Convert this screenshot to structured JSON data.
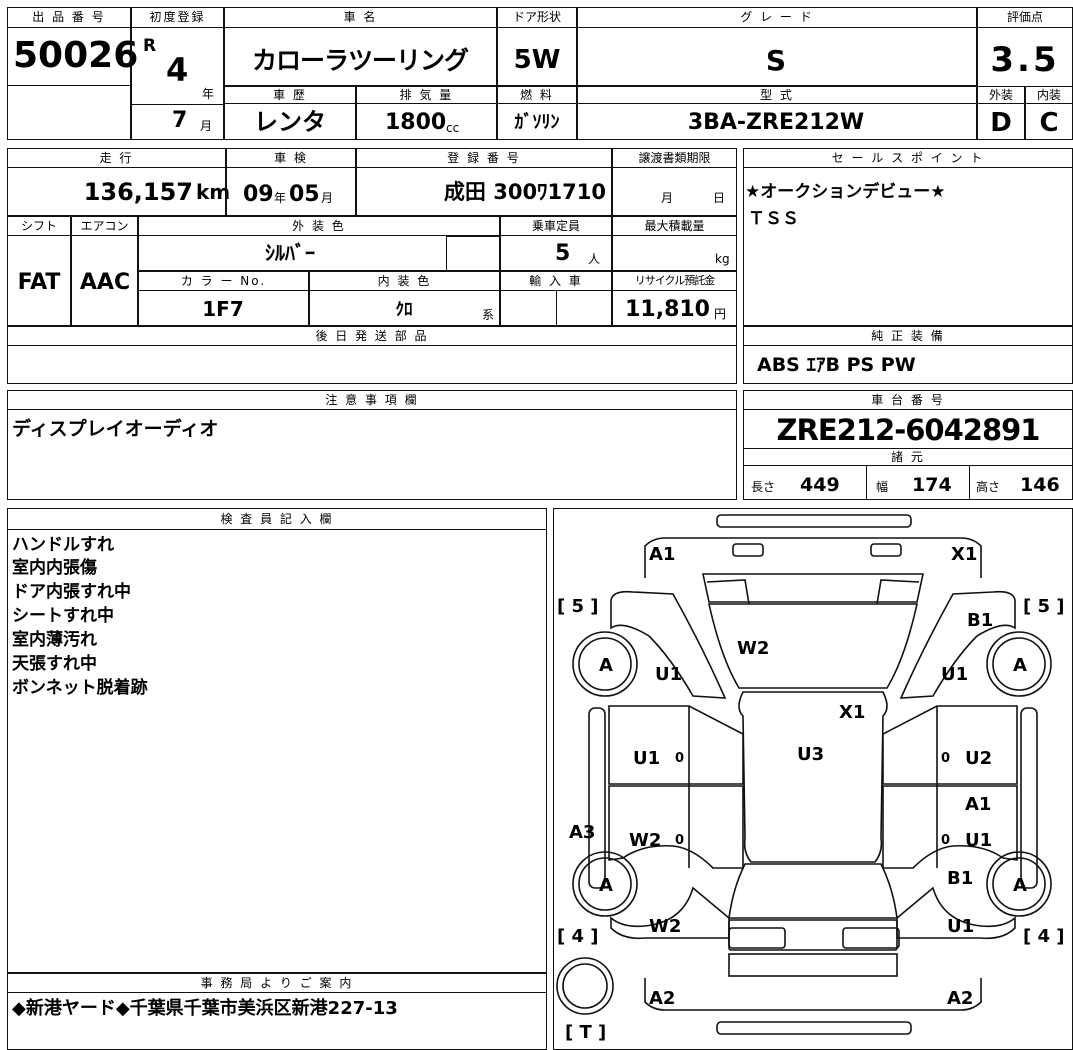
{
  "header": {
    "lot_number": {
      "label": "出 品 番 号",
      "value": "50026"
    },
    "first_registration": {
      "label": "初度登録",
      "era": "R",
      "year": "4",
      "year_unit": "年",
      "month": "7",
      "month_unit": "月"
    },
    "car_name": {
      "label": "車 名",
      "value": "カローラツーリング"
    },
    "door_type": {
      "label": "ドア形状",
      "value": "5W"
    },
    "grade": {
      "label": "グ レ ー ド",
      "value": "S"
    },
    "score": {
      "label": "評価点",
      "value": "3.5"
    },
    "history": {
      "label": "車 歴",
      "value": "レンタ"
    },
    "displacement": {
      "label": "排 気 量",
      "value": "1800",
      "unit": "cc"
    },
    "fuel": {
      "label": "燃 料",
      "value": "ｶﾞｿﾘﾝ"
    },
    "model_code": {
      "label": "型 式",
      "value": "3BA-ZRE212W"
    },
    "exterior_grade": {
      "label": "外装",
      "value": "D"
    },
    "interior_grade": {
      "label": "内装",
      "value": "C"
    }
  },
  "info": {
    "mileage": {
      "label": "走 行",
      "value": "136,157",
      "unit": "km"
    },
    "inspection": {
      "label": "車 検",
      "year": "09",
      "year_unit": "年",
      "month": "05",
      "month_unit": "月"
    },
    "registration": {
      "label": "登 録 番 号",
      "value": "成田 300ﾜ1710"
    },
    "transfer_deadline": {
      "label": "譲渡書類期限",
      "month_unit": "月",
      "day_unit": "日"
    },
    "shift": {
      "label": "シフト",
      "value": "FAT"
    },
    "aircon": {
      "label": "エアコン",
      "value": "AAC"
    },
    "exterior_color": {
      "label": "外 装 色",
      "value": "ｼﾙﾊﾞｰ"
    },
    "capacity": {
      "label": "乗車定員",
      "value": "5",
      "unit": "人"
    },
    "max_load": {
      "label": "最大積載量",
      "unit": "kg"
    },
    "color_no": {
      "label": "カ ラ ー No.",
      "value": "1F7"
    },
    "interior_color": {
      "label": "内 装 色",
      "value": "ｸﾛ",
      "unit": "系"
    },
    "import": {
      "label": "輸 入 車"
    },
    "recycle_fee": {
      "label": "リサイクル預託金",
      "value": "11,810",
      "unit": "円"
    },
    "later_parts": {
      "label": "後 日 発 送 部 品"
    }
  },
  "sales_points": {
    "label": "セ ー ル ス ポ イ ン ト",
    "lines": [
      "★オークションデビュー★",
      "ＴＳＳ"
    ]
  },
  "genuine_equipment": {
    "label": "純 正 装 備",
    "value": "ABS ｴｱB PS PW"
  },
  "notes": {
    "label": "注 意 事 項 欄",
    "value": "ディスプレイオーディオ"
  },
  "chassis": {
    "label": "車 台 番 号",
    "value": "ZRE212-6042891"
  },
  "dimensions": {
    "label": "諸 元",
    "length": {
      "label": "長さ",
      "value": "449"
    },
    "width": {
      "label": "幅",
      "value": "174"
    },
    "height": {
      "label": "高さ",
      "value": "146"
    }
  },
  "inspector": {
    "label": "検 査 員 記 入 欄",
    "lines": [
      "ハンドルすれ",
      "室内内張傷",
      "ドア内張すれ中",
      "シートすれ中",
      "室内薄汚れ",
      "天張すれ中",
      "ボンネット脱着跡"
    ]
  },
  "office": {
    "label": "事 務 局 よ り ご 案 内",
    "value": "◆新港ヤード◆千葉県千葉市美浜区新港227-13"
  },
  "diagram": {
    "marks": {
      "front_left": "A1",
      "front_right": "X1",
      "windshield": "W2",
      "left_front_fender": "U1",
      "right_front_fender": "U1",
      "roof_front": "X1",
      "left_front_door": "U1",
      "left_front_door_zero": "0",
      "roof": "U3",
      "right_front_door": "U2",
      "right_front_door_zero": "0",
      "right_rear_door_top": "A1",
      "right_rear_door": "U1",
      "right_rear_door_zero": "0",
      "left_rocker": "A3",
      "left_rear_door": "W2",
      "left_rear_door_zero": "0",
      "right_rear_fender": "B1",
      "right_front_fender_top": "B1",
      "rear_left_glass": "W2",
      "right_rear_bottom": "U1",
      "rear_left": "A2",
      "rear_right": "A2"
    },
    "tires": [
      "A",
      "A",
      "A",
      "A"
    ],
    "tire_bracket_fl": "[ 5 ]",
    "tire_bracket_fr": "[ 5 ]",
    "tire_bracket_rl": "[ 4 ]",
    "tire_bracket_rr": "[ 4 ]",
    "spare_tire": "[ T ]"
  }
}
